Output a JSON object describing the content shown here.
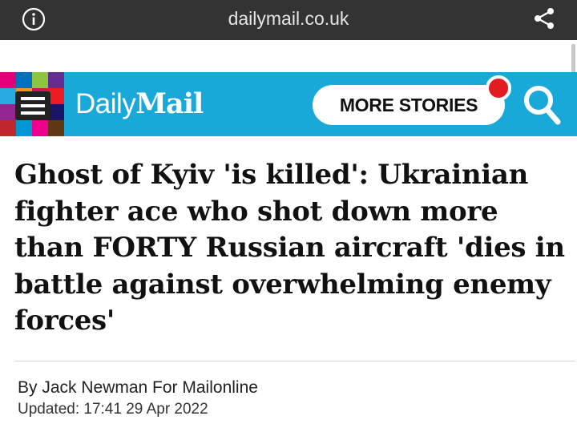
{
  "browser": {
    "url": "dailymail.co.uk",
    "info_icon": "info-icon",
    "share_icon": "share-icon"
  },
  "header": {
    "logo_daily": "Daily",
    "logo_mail": "Mail",
    "more_stories_label": "MORE STORIES",
    "menu_icon": "hamburger-menu-icon",
    "search_icon": "search-icon",
    "brand_color": "#19a9d9",
    "notification_color": "#e31b23"
  },
  "article": {
    "headline": "Ghost of Kyiv 'is killed': Ukrainian fighter ace who shot down more than FORTY Russian aircraft 'dies in battle against overwhelming enemy forces'",
    "byline": "By Jack Newman For Mailonline",
    "updated": "Updated: 17:41 29 Apr 2022"
  }
}
